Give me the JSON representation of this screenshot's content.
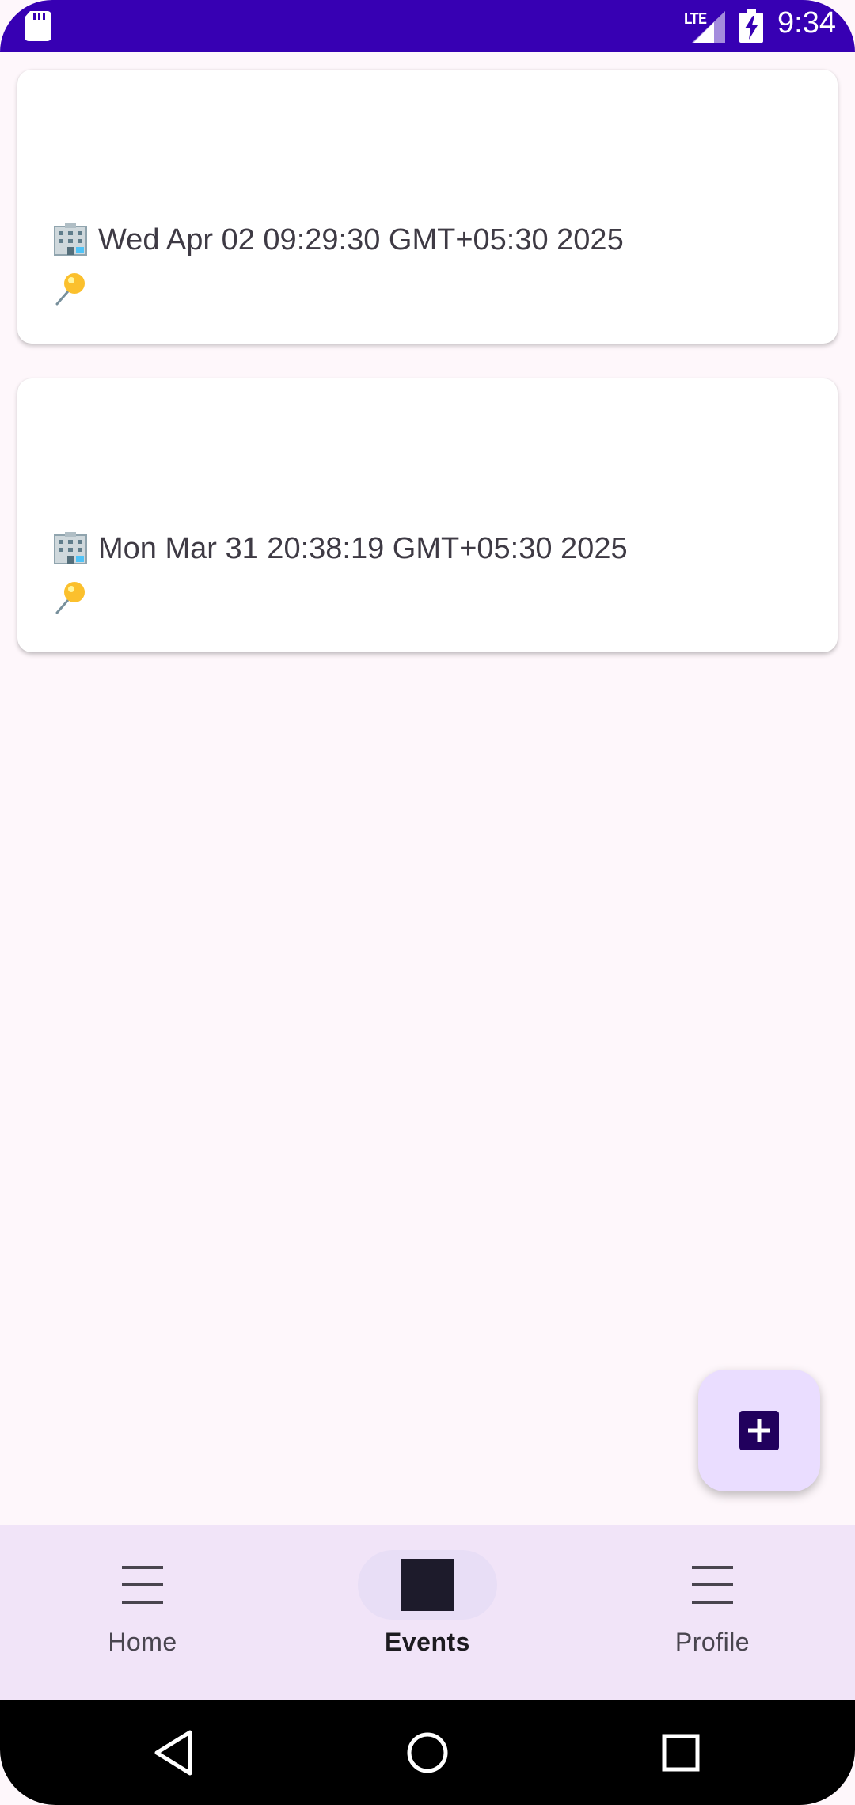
{
  "status_bar": {
    "network": "LTE",
    "time": "9:34"
  },
  "events": [
    {
      "date": "Wed Apr 02 09:29:30 GMT+05:30 2025"
    },
    {
      "date": "Mon Mar 31 20:38:19 GMT+05:30 2025"
    }
  ],
  "nav": {
    "items": [
      {
        "label": "Home",
        "icon": "menu-icon",
        "active": false
      },
      {
        "label": "Events",
        "icon": "square-icon",
        "active": true
      },
      {
        "label": "Profile",
        "icon": "menu-icon",
        "active": false
      }
    ]
  },
  "colors": {
    "status_bar": "#3700b3",
    "background": "#fef7fb",
    "fab": "#eaddff",
    "bottom_nav": "#f1e4f8"
  }
}
